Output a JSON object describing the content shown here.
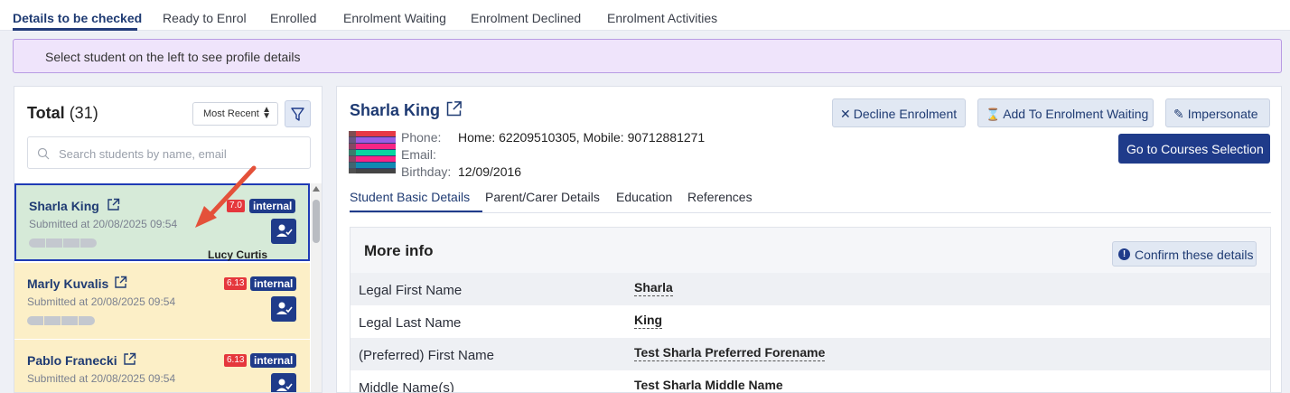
{
  "tabs": [
    {
      "label": "Details to be checked"
    },
    {
      "label": "Ready to Enrol"
    },
    {
      "label": "Enrolled"
    },
    {
      "label": "Enrolment Waiting"
    },
    {
      "label": "Enrolment Declined"
    },
    {
      "label": "Enrolment Activities"
    }
  ],
  "banner": "Select student on the left to see profile details",
  "left": {
    "total_label": "Total",
    "total_count": "(31)",
    "sort_label": "Most Recent",
    "search_placeholder": "Search students by name, email",
    "students": [
      {
        "name": "Sharla King",
        "submitted": "Submitted at 20/08/2025 09:54",
        "score": "7.0",
        "tag": "internal",
        "assignee": "Lucy Curtis"
      },
      {
        "name": "Marly Kuvalis",
        "submitted": "Submitted at 20/08/2025 09:54",
        "score": "6.13",
        "tag": "internal"
      },
      {
        "name": "Pablo Franecki",
        "submitted": "Submitted at 20/08/2025 09:54",
        "score": "6.13",
        "tag": "internal"
      }
    ]
  },
  "profile": {
    "name": "Sharla King",
    "phone_label": "Phone:",
    "phone_value": "Home: 62209510305, Mobile: 90712881271",
    "email_label": "Email:",
    "birthday_label": "Birthday:",
    "birthday_value": "12/09/2016",
    "buttons": {
      "decline": "Decline Enrolment",
      "waiting": "Add To Enrolment Waiting",
      "impersonate": "Impersonate",
      "courses": "Go to Courses Selection"
    },
    "sub_tabs": [
      "Student Basic Details",
      "Parent/Carer Details",
      "Education",
      "References"
    ],
    "more_info_title": "More info",
    "confirm_label": "Confirm these details",
    "fields": [
      {
        "label": "Legal First Name",
        "value": "Sharla"
      },
      {
        "label": "Legal Last Name",
        "value": "King"
      },
      {
        "label": "(Preferred) First Name",
        "value": "Test Sharla Preferred Forename"
      },
      {
        "label": "Middle Name(s)",
        "value": "Test Sharla Middle Name"
      }
    ]
  },
  "colors": {
    "primary": "#1f3b8a",
    "selected_card": "#d6ead8",
    "card": "#fcefc7",
    "score": "#e5373c",
    "banner": "#efe4fb"
  }
}
